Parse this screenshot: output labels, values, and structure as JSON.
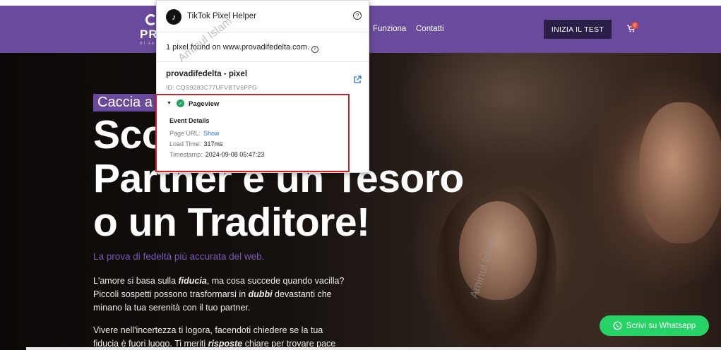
{
  "nav": {
    "logo_text": "PRO",
    "logo_sub": "DI FEDELTÀ",
    "links": [
      "Funziona",
      "Contatti"
    ],
    "cta": "INIZIA IL TEST",
    "cart_count": "0"
  },
  "hero": {
    "kicker": "Caccia a",
    "headline_lines": [
      "Sco            o",
      "Partner è un Tesoro",
      "o un Traditore!"
    ],
    "tagline": "La prova di fedeltà più accurata del web.",
    "para1": [
      "L'amore si basa sulla ",
      "fiducia",
      ", ma cosa succede quando vacilla? Piccoli sospetti possono trasformarsi in ",
      "dubbi",
      " devastanti che minano la tua serenità con il tuo partner."
    ],
    "para2": [
      "Vivere nell'incertezza ti logora, facendoti chiedere se la tua fiducia è fuori luogo. Ti meriti ",
      "risposte",
      " chiare per trovare pace"
    ]
  },
  "whatsapp": {
    "label": "Scrivi su Whatsapp"
  },
  "popup": {
    "title": "TikTok Pixel Helper",
    "found": "1 pixel found on www.provadifedelta.com.",
    "pixel_name": "provadifedelta - pixel",
    "pixel_id": "ID:  CQS9283C77UFVB7V6PPG",
    "event": {
      "name": "Pageview",
      "details_title": "Event Details",
      "page_url_label": "Page URL:",
      "page_url_value": "Show",
      "load_time_label": "Load Time:",
      "load_time_value": "317ms",
      "timestamp_label": "Timestamp:",
      "timestamp_value": "2024-09-08 05:47:23"
    }
  },
  "watermark": "Aminul Islam",
  "colors": {
    "nav_bg": "#6a4a9c",
    "cta_bg": "#2b1f48",
    "whatsapp": "#25d366",
    "highlight_box": "#d0202a",
    "tagline": "#7b56b8"
  }
}
